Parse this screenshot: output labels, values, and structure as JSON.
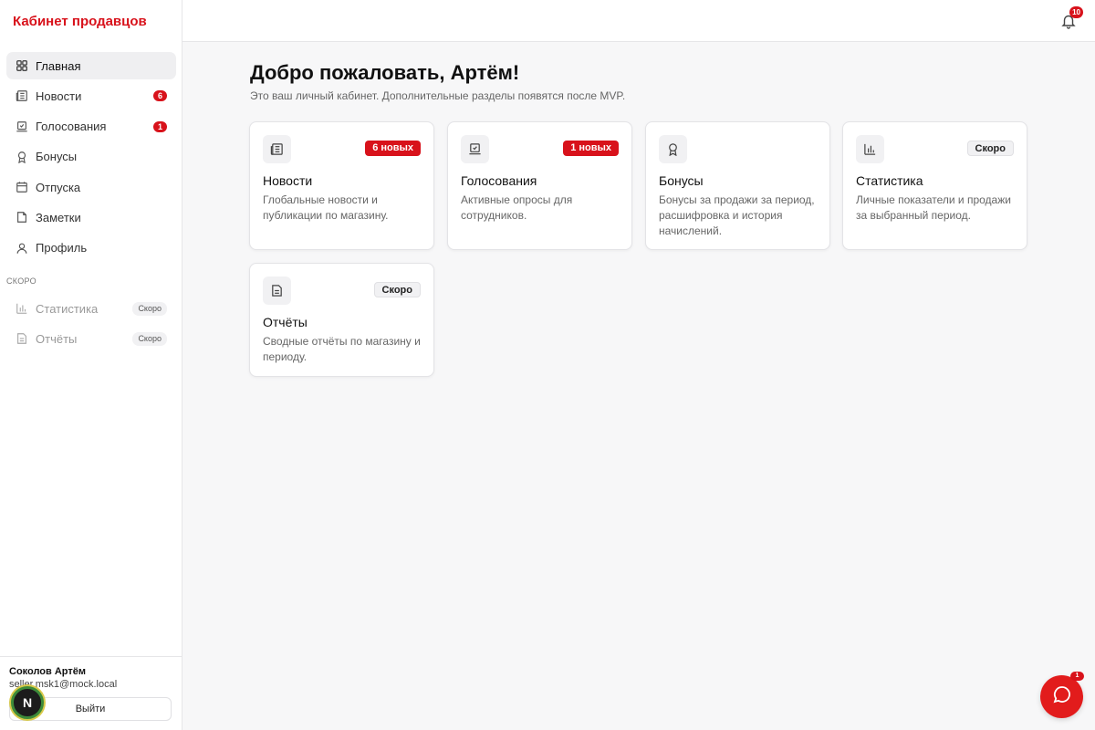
{
  "app": {
    "title": "Кабинет продавцов"
  },
  "sidebar": {
    "items": [
      {
        "label": "Главная",
        "icon": "grid-icon",
        "active": true
      },
      {
        "label": "Новости",
        "icon": "newspaper-icon",
        "badge": "6"
      },
      {
        "label": "Голосования",
        "icon": "vote-icon",
        "badge": "1"
      },
      {
        "label": "Бонусы",
        "icon": "award-icon"
      },
      {
        "label": "Отпуска",
        "icon": "calendar-icon"
      },
      {
        "label": "Заметки",
        "icon": "note-icon"
      },
      {
        "label": "Профиль",
        "icon": "user-icon"
      }
    ],
    "soon_heading": "СКОРО",
    "soon_items": [
      {
        "label": "Статистика",
        "icon": "bar-chart-icon",
        "pill": "Скоро"
      },
      {
        "label": "Отчёты",
        "icon": "document-icon",
        "pill": "Скоро"
      }
    ]
  },
  "user": {
    "name": "Соколов Артём",
    "email": "seller.msk1@mock.local",
    "logout_label": "Выйти",
    "avatar_letter": "N"
  },
  "topbar": {
    "notifications_count": "10"
  },
  "main": {
    "welcome": "Добро пожаловать, Артём!",
    "subtitle": "Это ваш личный кабинет. Дополнительные разделы появятся после MVP.",
    "cards": [
      {
        "title": "Новости",
        "desc": "Глобальные новости и публикации по магазину.",
        "badge": "6 новых",
        "badge_style": "red",
        "icon": "newspaper-icon"
      },
      {
        "title": "Голосования",
        "desc": "Активные опросы для сотрудников.",
        "badge": "1 новых",
        "badge_style": "red",
        "icon": "vote-icon"
      },
      {
        "title": "Бонусы",
        "desc": "Бонусы за продажи за период, расшифровка и история начислений.",
        "badge": "",
        "icon": "award-icon"
      },
      {
        "title": "Статистика",
        "desc": "Личные показатели и продажи за выбранный период.",
        "badge": "Скоро",
        "badge_style": "gray",
        "icon": "bar-chart-icon"
      },
      {
        "title": "Отчёты",
        "desc": "Сводные отчёты по магазину и периоду.",
        "badge": "Скоро",
        "badge_style": "gray",
        "icon": "document-icon"
      }
    ]
  },
  "chat": {
    "badge": "1"
  },
  "colors": {
    "accent": "#d8121b",
    "background": "#f7f7f8",
    "card": "#ffffff"
  }
}
